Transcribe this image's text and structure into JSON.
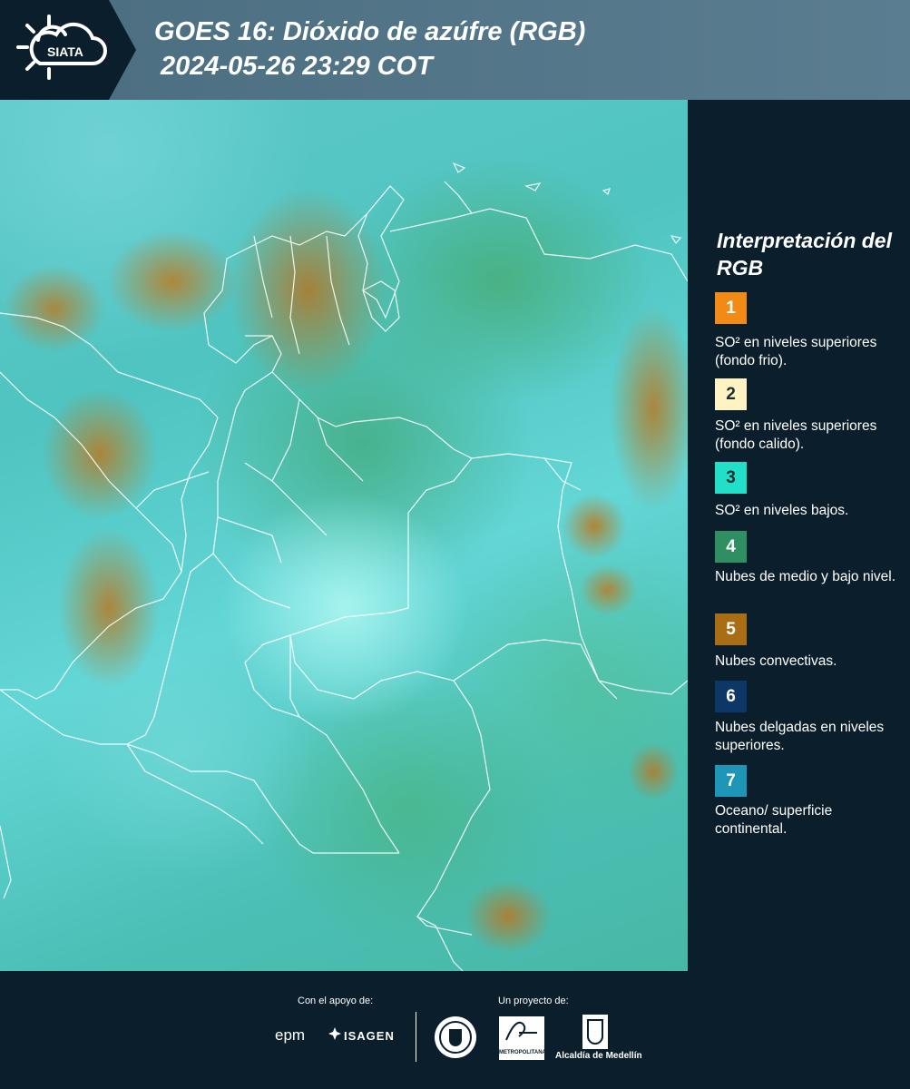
{
  "header": {
    "logo_text": "SIATA",
    "title_line1": "GOES 16: Dióxido de azúfre (RGB)",
    "title_line2": "2024-05-26 23:29 COT"
  },
  "legend": {
    "title": "Interpretación del RGB",
    "items": [
      {
        "number": "1",
        "color": "#f28a16",
        "text": "SO² en niveles superiores (fondo frio)."
      },
      {
        "number": "2",
        "color": "#fff3c4",
        "text": "SO² en niveles superiores (fondo calido)."
      },
      {
        "number": "3",
        "color": "#22e0c8",
        "text": "SO² en niveles bajos."
      },
      {
        "number": "4",
        "color": "#2f8f63",
        "text": "Nubes de medio y bajo nivel."
      },
      {
        "number": "5",
        "color": "#a96d16",
        "text": "Nubes convectivas."
      },
      {
        "number": "6",
        "color": "#0c3766",
        "text": "Nubes delgadas en niveles superiores."
      },
      {
        "number": "7",
        "color": "#1e96b8",
        "text": "Oceano/ superficie continental."
      }
    ]
  },
  "footer": {
    "support_label": "Con el apoyo de:",
    "project_label": "Un proyecto de:",
    "sponsors": [
      "epm",
      "ISAGEN"
    ],
    "partners": [
      "METROPOLITANA",
      "Alcaldía de Medellín"
    ]
  }
}
